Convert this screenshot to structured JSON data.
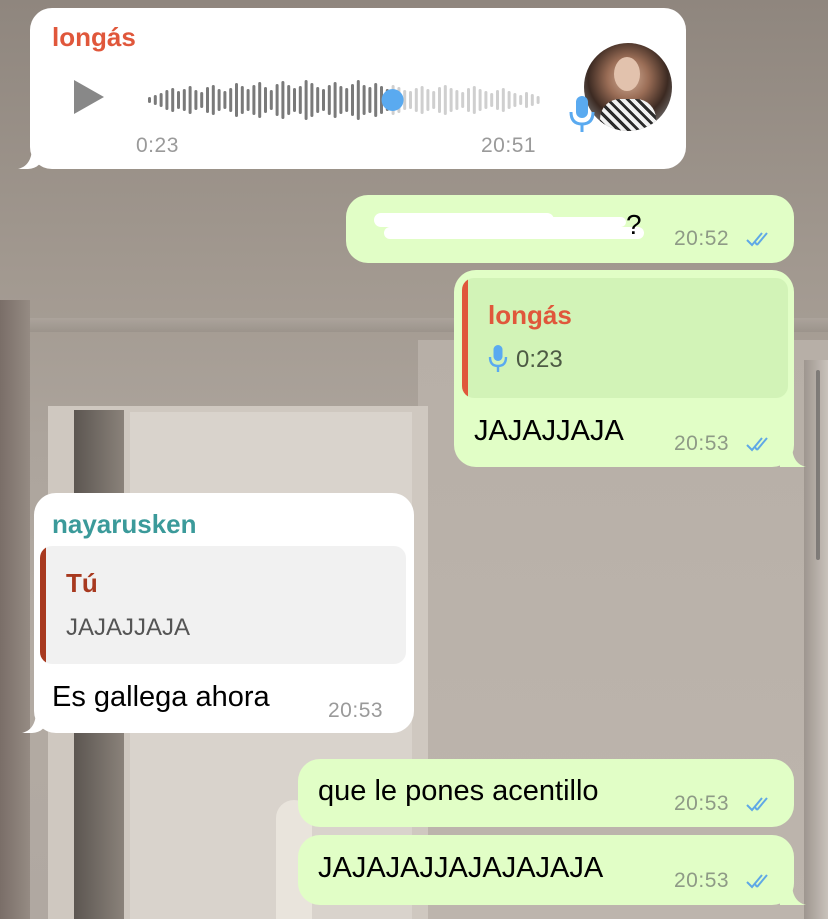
{
  "colors": {
    "incoming_bubble": "#ffffff",
    "outgoing_bubble": "#e1fec6",
    "sender_longas": "#e0573b",
    "sender_nayarusken": "#3b9a9a",
    "reply_tu": "#a8391f",
    "read_checks": "#5fa8e6",
    "voice_progress": "#5aaaf0"
  },
  "messages": [
    {
      "id": "voice",
      "direction": "in",
      "sender": "longás",
      "type": "voice",
      "duration": "0:23",
      "time": "20:51",
      "played_fraction": 0.62,
      "icons": [
        "play-icon",
        "waveform",
        "avatar",
        "mic-icon"
      ]
    },
    {
      "id": "redacted",
      "direction": "out",
      "text": "?",
      "time": "20:52",
      "status": "read"
    },
    {
      "id": "reply-jaja",
      "direction": "out",
      "reply_to": {
        "sender": "longás",
        "preview": "0:23",
        "preview_icon": "mic-icon"
      },
      "text": "JAJAJJAJA",
      "time": "20:53",
      "status": "read"
    },
    {
      "id": "gallega",
      "direction": "in",
      "sender": "nayarusken",
      "reply_to": {
        "sender": "Tú",
        "preview": "JAJAJJAJA"
      },
      "text": "Es gallega ahora",
      "time": "20:53"
    },
    {
      "id": "acentillo",
      "direction": "out",
      "text": "que le pones acentillo",
      "time": "20:53",
      "status": "read"
    },
    {
      "id": "jajaja",
      "direction": "out",
      "text": "JAJAJAJJAJAJAJAJA",
      "time": "20:53",
      "status": "read"
    }
  ]
}
